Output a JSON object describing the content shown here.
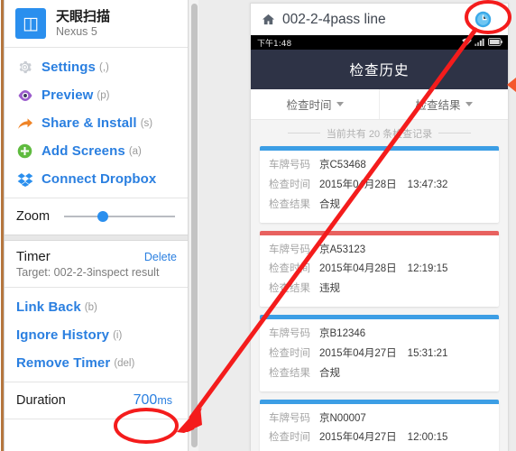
{
  "sidebar": {
    "app": {
      "logo_icon": "app-logo-icon",
      "logo_glyph": "◫",
      "name": "天眼扫描",
      "device": "Nexus 5"
    },
    "menu": [
      {
        "label": "Settings",
        "key": "(,)",
        "icon": "gear-icon"
      },
      {
        "label": "Preview",
        "key": "(p)",
        "icon": "eye-icon"
      },
      {
        "label": "Share & Install",
        "key": "(s)",
        "icon": "share-arrow-icon"
      },
      {
        "label": "Add Screens",
        "key": "(a)",
        "icon": "plus-circle-icon"
      },
      {
        "label": "Connect Dropbox",
        "key": "",
        "icon": "dropbox-icon"
      }
    ],
    "zoom": {
      "label": "Zoom",
      "value_percent": 35
    },
    "timer": {
      "title": "Timer",
      "delete_label": "Delete",
      "target": "Target: 002-2-3inspect result"
    },
    "actions": [
      {
        "label": "Link Back",
        "key": "(b)"
      },
      {
        "label": "Ignore History",
        "key": "(i)"
      },
      {
        "label": "Remove Timer",
        "key": "(del)"
      }
    ],
    "duration": {
      "label": "Duration",
      "number": "700",
      "unit": "ms"
    }
  },
  "phone": {
    "titlebar": {
      "home_icon": "home-icon",
      "screen_name": "002-2-4pass line",
      "clock_icon": "clock-icon"
    },
    "status_bar": {
      "time": "下午1:48",
      "icons": [
        "wifi-icon",
        "signal-icon",
        "battery-icon"
      ]
    },
    "nav_title": "检查历史",
    "filters": [
      {
        "label": "检查时间",
        "icon": "chevron-down-icon"
      },
      {
        "label": "检查结果",
        "icon": "chevron-down-icon"
      }
    ],
    "count_text": "当前共有 20 条检查记录",
    "field_labels": {
      "plate": "车牌号码",
      "time": "检查时间",
      "result": "检查结果"
    },
    "records": [
      {
        "stripe": "#3c9ee5",
        "plate": "京C53468",
        "date": "2015年04月28日",
        "time": "13:47:32",
        "result": "合规"
      },
      {
        "stripe": "#e8615f",
        "plate": "京A53123",
        "date": "2015年04月28日",
        "time": "12:19:15",
        "result": "违规"
      },
      {
        "stripe": "#3c9ee5",
        "plate": "京B12346",
        "date": "2015年04月27日",
        "time": "15:31:21",
        "result": "合规"
      },
      {
        "stripe": "#3c9ee5",
        "plate": "京N00007",
        "date": "2015年04月27日",
        "time": "12:00:15",
        "result": ""
      }
    ]
  },
  "colors": {
    "accent_blue": "#2a7fe0",
    "annotation_red": "#f41c1c",
    "marker_orange": "#f4572c",
    "nav_dark": "#2e3346",
    "card_blue": "#3c9ee5",
    "card_red": "#e8615f"
  }
}
